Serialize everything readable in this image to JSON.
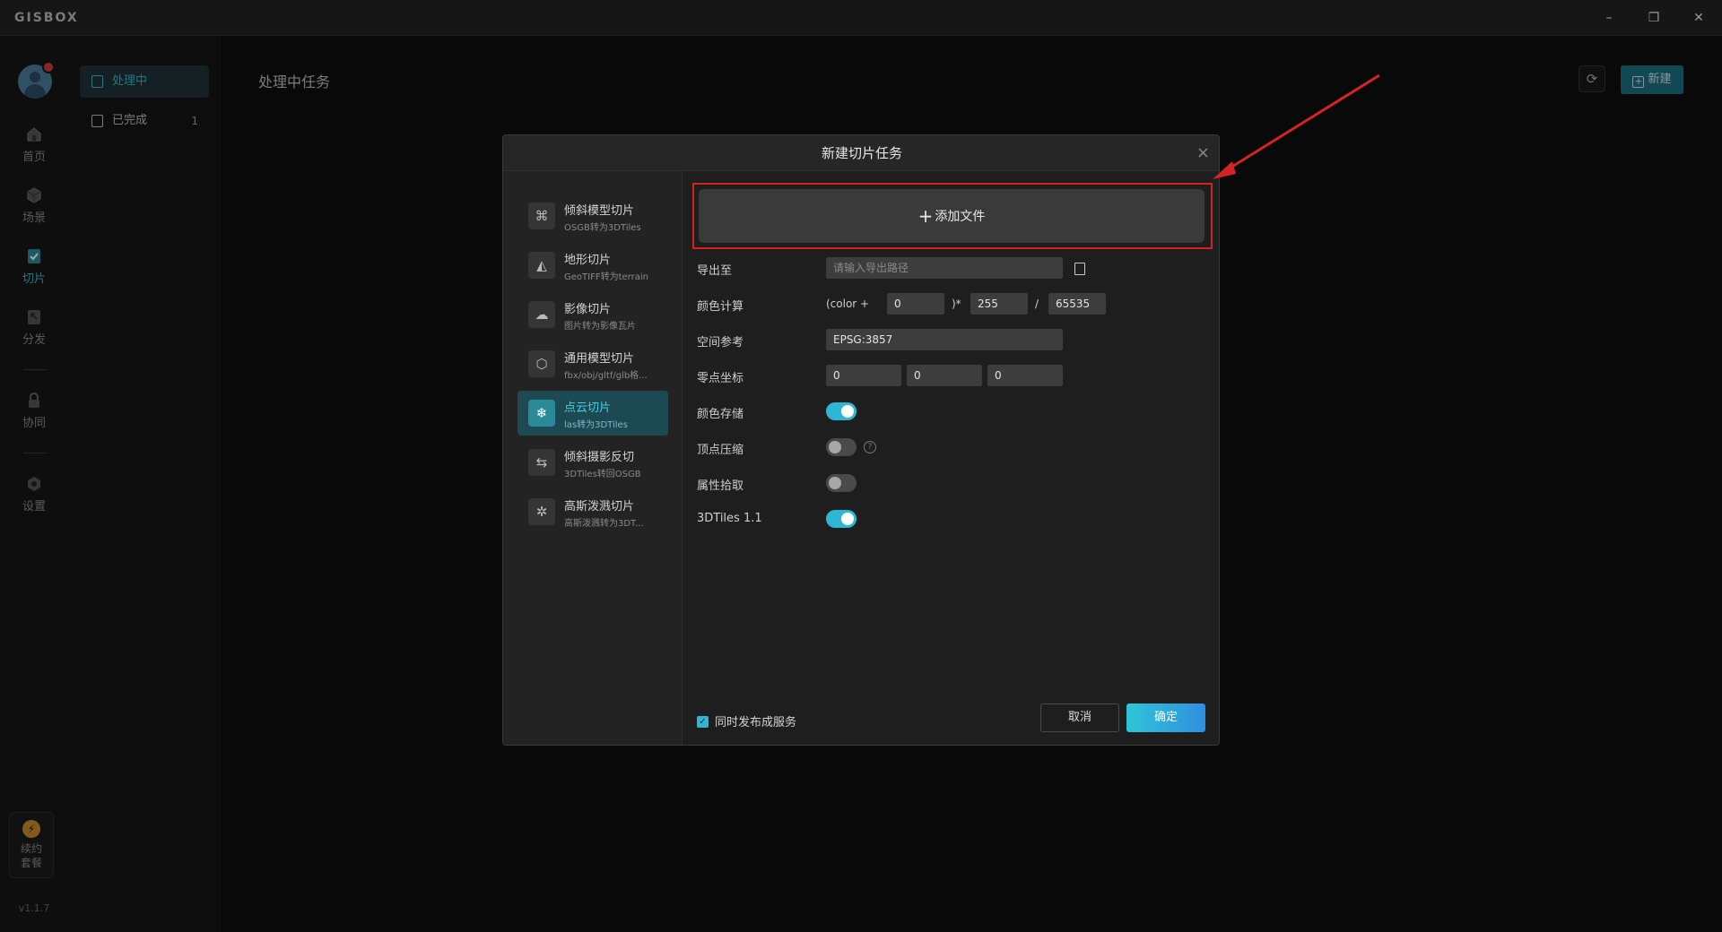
{
  "app": {
    "logo": "GISBOX",
    "version": "v1.1.7"
  },
  "window_controls": {
    "minimize": "–",
    "restore": "❐",
    "close": "✕"
  },
  "rail": {
    "items": [
      {
        "label": "首页",
        "icon": "home-icon"
      },
      {
        "label": "场景",
        "icon": "scene-icon"
      },
      {
        "label": "切片",
        "icon": "slice-icon",
        "active": true
      },
      {
        "label": "分发",
        "icon": "distribute-icon"
      },
      {
        "label": "协同",
        "icon": "collaborate-icon"
      },
      {
        "label": "设置",
        "icon": "settings-icon"
      }
    ],
    "renew": {
      "line1": "续约",
      "line2": "套餐",
      "coin": "⚡"
    }
  },
  "subnav": {
    "items": [
      {
        "label": "处理中",
        "active": true
      },
      {
        "label": "已完成",
        "count": "1"
      }
    ]
  },
  "main": {
    "title": "处理中任务",
    "new_button": "新建",
    "new_button_plus": "+",
    "refresh_glyph": "⟳"
  },
  "modal": {
    "title": "新建切片任务",
    "close_glyph": "×",
    "types": [
      {
        "name": "倾斜模型切片",
        "desc": "OSGB转为3DTiles",
        "glyph": "⌘"
      },
      {
        "name": "地形切片",
        "desc": "GeoTIFF转为terrain",
        "glyph": "◭"
      },
      {
        "name": "影像切片",
        "desc": "图片转为影像瓦片",
        "glyph": "☁"
      },
      {
        "name": "通用模型切片",
        "desc": "fbx/obj/gltf/glb格...",
        "glyph": "⬡"
      },
      {
        "name": "点云切片",
        "desc": "las转为3DTiles",
        "glyph": "❄",
        "active": true
      },
      {
        "name": "倾斜摄影反切",
        "desc": "3DTiles转回OSGB",
        "glyph": "⇆"
      },
      {
        "name": "高斯泼溅切片",
        "desc": "高斯泼溅转为3DT...",
        "glyph": "✲"
      }
    ],
    "add_file": {
      "plus": "+",
      "label": "添加文件"
    },
    "form": {
      "export_label": "导出至",
      "export_placeholder": "请输入导出路径",
      "color_calc_label": "颜色计算",
      "color_prefix": "(color +",
      "color_offset": "0",
      "color_mid": ")*",
      "color_mult": "255",
      "color_div": "/",
      "color_divisor": "65535",
      "srs_label": "空间参考",
      "srs_value": "EPSG:3857",
      "origin_label": "零点坐标",
      "origin_x": "0",
      "origin_y": "0",
      "origin_z": "0",
      "color_store_label": "颜色存储",
      "color_store_on": true,
      "vertex_compress_label": "顶点压缩",
      "vertex_compress_on": false,
      "vertex_help": "?",
      "attr_pick_label": "属性拾取",
      "attr_pick_on": false,
      "tiles11_label": "3DTiles 1.1",
      "tiles11_on": true
    },
    "publish_label": "同时发布成服务",
    "publish_checked": true,
    "check_glyph": "✓",
    "cancel_label": "取消",
    "confirm_label": "确定"
  },
  "colors": {
    "accent": "#3ab5c8",
    "toggle_on": "#2fb6d5",
    "annotation_red": "#d32424"
  }
}
